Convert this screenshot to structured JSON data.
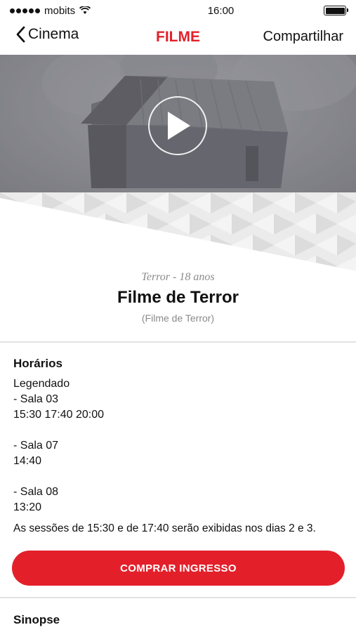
{
  "status": {
    "carrier": "mobits",
    "time": "16:00"
  },
  "nav": {
    "back_label": "Cinema",
    "title": "FILME",
    "share_label": "Compartilhar"
  },
  "movie": {
    "genre": "Terror - 18 anos",
    "title": "Filme de Terror",
    "original_title": "(Filme de Terror)"
  },
  "schedule": {
    "title": "Horários",
    "format": "Legendado",
    "rooms": [
      {
        "room": "- Sala 03",
        "times": "15:30 17:40 20:00"
      },
      {
        "room": "- Sala 07",
        "times": "14:40"
      },
      {
        "room": "- Sala 08",
        "times": "13:20"
      }
    ],
    "note": "As sessões de 15:30 e de 17:40 serão exibidas nos dias 2 e 3."
  },
  "buy_button": {
    "label": "COMPRAR INGRESSO"
  },
  "synopsis": {
    "title": "Sinopse"
  },
  "colors": {
    "accent": "#e3202a",
    "text": "#111111",
    "muted": "#8a8a8a"
  }
}
